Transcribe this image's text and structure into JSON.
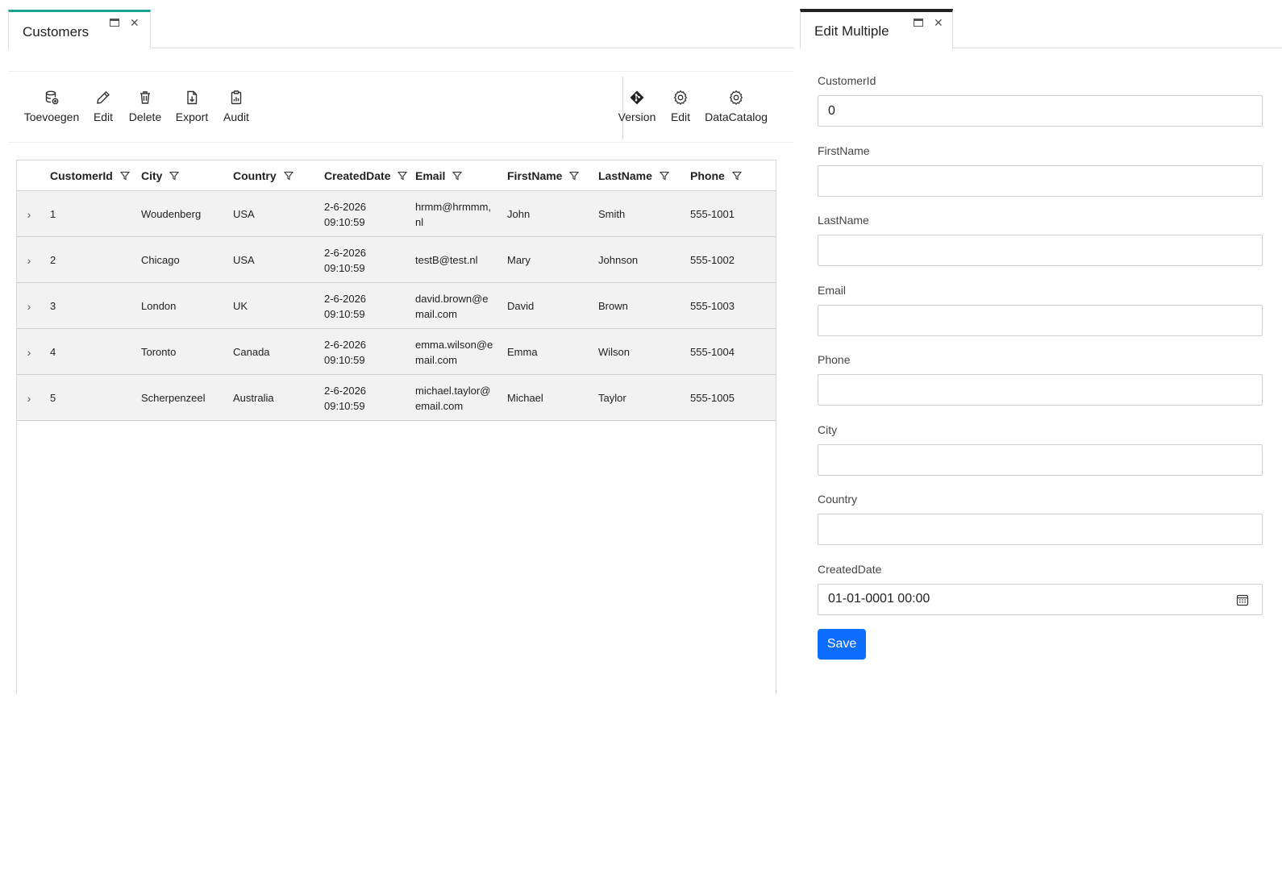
{
  "left_panel": {
    "tab_title": "Customers",
    "toolbar": {
      "left_buttons": [
        {
          "label": "Toevoegen",
          "icon": "database-add-icon"
        },
        {
          "label": "Edit",
          "icon": "pencil-icon"
        },
        {
          "label": "Delete",
          "icon": "trash-icon"
        },
        {
          "label": "Export",
          "icon": "file-export-icon"
        },
        {
          "label": "Audit",
          "icon": "clipboard-chart-icon"
        }
      ],
      "right_buttons": [
        {
          "label": "Version",
          "icon": "git-diamond-icon"
        },
        {
          "label": "Edit",
          "icon": "gear-icon"
        },
        {
          "label": "DataCatalog",
          "icon": "gear-icon"
        }
      ]
    },
    "grid": {
      "columns": [
        "CustomerId",
        "City",
        "Country",
        "CreatedDate",
        "Email",
        "FirstName",
        "LastName",
        "Phone"
      ],
      "rows": [
        {
          "CustomerId": "1",
          "City": "Woudenberg",
          "Country": "USA",
          "CreatedDate": [
            "2-6-2026",
            "09:10:59"
          ],
          "Email": [
            "hrmm@hrmmm,",
            "nl"
          ],
          "FirstName": "John",
          "LastName": "Smith",
          "Phone": "555-1001"
        },
        {
          "CustomerId": "2",
          "City": "Chicago",
          "Country": "USA",
          "CreatedDate": [
            "2-6-2026",
            "09:10:59"
          ],
          "Email": [
            "testB@test.nl"
          ],
          "FirstName": "Mary",
          "LastName": "Johnson",
          "Phone": "555-1002"
        },
        {
          "CustomerId": "3",
          "City": "London",
          "Country": "UK",
          "CreatedDate": [
            "2-6-2026",
            "09:10:59"
          ],
          "Email": [
            "david.brown@e",
            "mail.com"
          ],
          "FirstName": "David",
          "LastName": "Brown",
          "Phone": "555-1003"
        },
        {
          "CustomerId": "4",
          "City": "Toronto",
          "Country": "Canada",
          "CreatedDate": [
            "2-6-2026",
            "09:10:59"
          ],
          "Email": [
            "emma.wilson@e",
            "mail.com"
          ],
          "FirstName": "Emma",
          "LastName": "Wilson",
          "Phone": "555-1004"
        },
        {
          "CustomerId": "5",
          "City": "Scherpenzeel",
          "Country": "Australia",
          "CreatedDate": [
            "2-6-2026",
            "09:10:59"
          ],
          "Email": [
            "michael.taylor@",
            "email.com"
          ],
          "FirstName": "Michael",
          "LastName": "Taylor",
          "Phone": "555-1005"
        }
      ]
    }
  },
  "right_panel": {
    "tab_title": "Edit Multiple",
    "fields": [
      {
        "label": "CustomerId",
        "value": "0"
      },
      {
        "label": "FirstName",
        "value": ""
      },
      {
        "label": "LastName",
        "value": ""
      },
      {
        "label": "Email",
        "value": ""
      },
      {
        "label": "Phone",
        "value": ""
      },
      {
        "label": "City",
        "value": ""
      },
      {
        "label": "Country",
        "value": ""
      },
      {
        "label": "CreatedDate",
        "value": "01-01-0001 00:00"
      }
    ],
    "save_label": "Save"
  },
  "colors": {
    "accent_tab": "#1aa393",
    "active_tab_dark": "#222222",
    "primary_button": "#0d6efd"
  }
}
